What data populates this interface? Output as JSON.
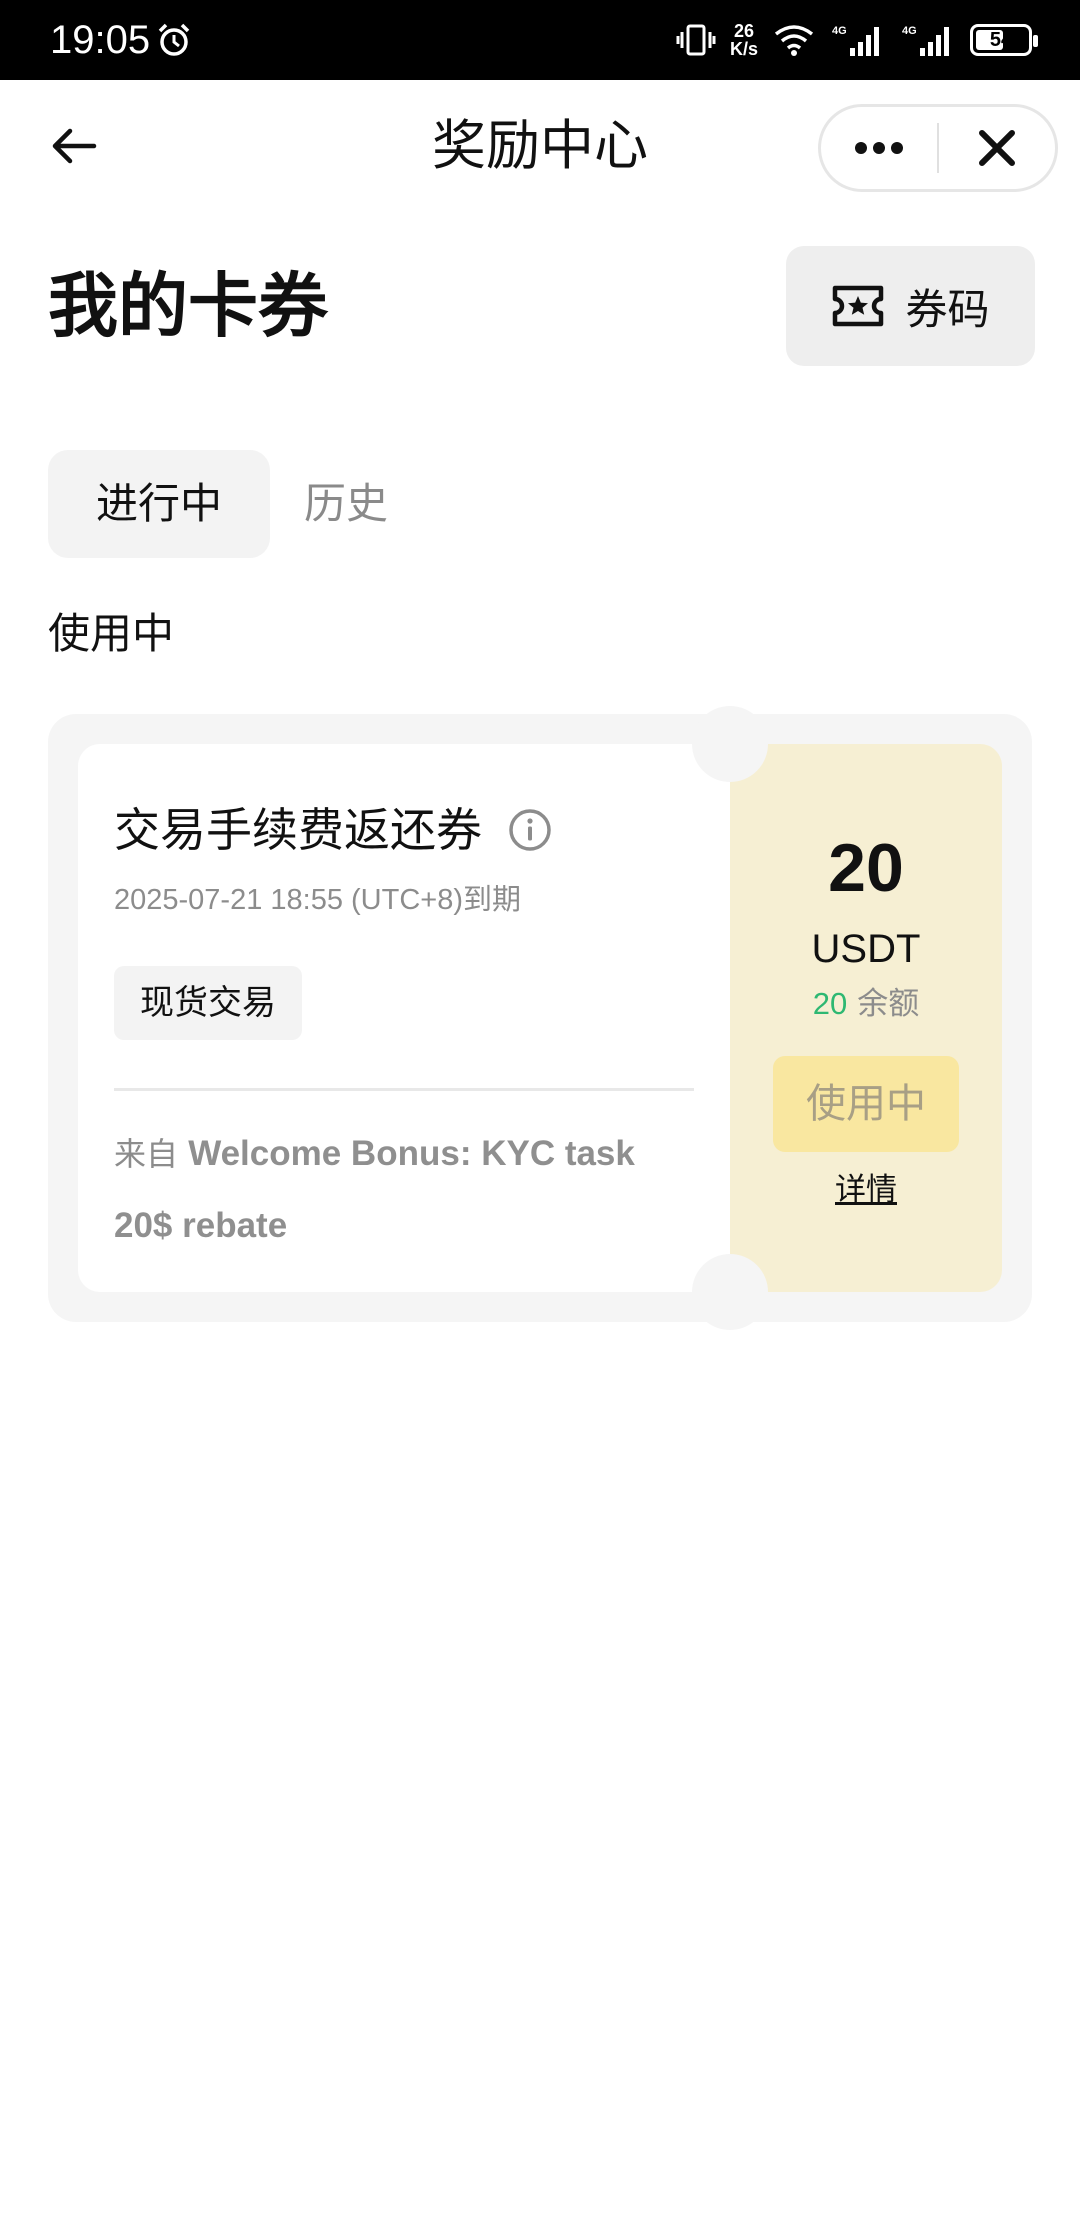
{
  "status_bar": {
    "time": "19:05",
    "net_speed_value": "26",
    "net_speed_unit": "K/s",
    "net_type": "4G",
    "battery": "54",
    "battery_fraction": 0.54
  },
  "nav": {
    "title": "奖励中心",
    "more_icon": "more-dots-icon",
    "close_icon": "close-icon"
  },
  "header": {
    "title": "我的卡券",
    "code_button_label": "券码"
  },
  "tabs": [
    {
      "label": "进行中",
      "active": true
    },
    {
      "label": "历史",
      "active": false
    }
  ],
  "section": {
    "title": "使用中"
  },
  "coupon": {
    "name": "交易手续费返还券",
    "expiry": "2025-07-21 18:55 (UTC+8)到期",
    "tag": "现货交易",
    "source_prefix": "来自",
    "source_name": "Welcome Bonus: KYC task 20$ rebate",
    "amount": "20",
    "unit": "USDT",
    "balance_value": "20",
    "balance_label": "余额",
    "status_label": "使用中",
    "details_label": "详情",
    "colors": {
      "stub_bg": "#f6efd3",
      "status_btn_bg": "#f9e7a0",
      "balance_green": "#2eb872"
    }
  }
}
